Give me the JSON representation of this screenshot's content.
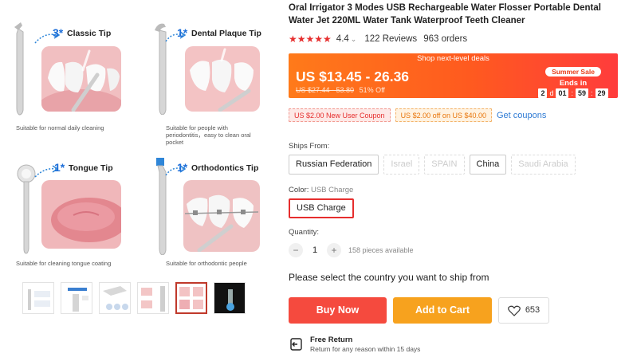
{
  "gallery": {
    "tiles": [
      {
        "num": "3*",
        "title": "Classic Tip",
        "caption": "Suitable for normal daily cleaning"
      },
      {
        "num": "1*",
        "title": "Dental Plaque Tip",
        "caption": "Suitable for people with periodontitis，easy to clean oral pocket"
      },
      {
        "num": "1*",
        "title": "Tongue Tip",
        "caption": "Suitable for cleaning tongue coating"
      },
      {
        "num": "1*",
        "title": "Orthodontics Tip",
        "caption": "Suitable for orthodontic people"
      }
    ],
    "thumbnails": [
      "thumb-1",
      "thumb-2",
      "thumb-3",
      "thumb-4",
      "thumb-5",
      "thumb-6"
    ],
    "active_thumbnail_index": 4
  },
  "product": {
    "title": "Oral Irrigator 3 Modes USB Rechargeable Water Flosser Portable Dental Water Jet 220ML Water Tank Waterproof Teeth Cleaner",
    "stars": "★★★★★",
    "rating": "4.4",
    "reviews": "122 Reviews",
    "orders": "963 orders"
  },
  "promo": {
    "banner": "Shop next-level deals",
    "price": "US $13.45 - 26.36",
    "old_price": "US $27.44 - 53.80",
    "discount": "51% Off",
    "badge": "Summer Sale",
    "ends_label": "Ends in",
    "timer": {
      "days": "2",
      "days_unit": "d",
      "hours": "01",
      "minutes": "59",
      "seconds": "29"
    }
  },
  "coupons": {
    "new_user": "US $2.00 New User Coupon",
    "off": "US $2.00 off on US $40.00",
    "link": "Get coupons"
  },
  "ships_from": {
    "label": "Ships From:",
    "options": [
      "Russian Federation",
      "Israel",
      "SPAIN",
      "China",
      "Saudi Arabia"
    ]
  },
  "color": {
    "label": "Color:",
    "value": "USB Charge",
    "options": [
      "USB Charge"
    ]
  },
  "quantity": {
    "label": "Quantity:",
    "minus": "−",
    "value": "1",
    "plus": "+",
    "available": "158 pieces available"
  },
  "ship_note": "Please select the country you want to ship from",
  "actions": {
    "buy_now": "Buy Now",
    "add_to_cart": "Add to Cart",
    "wishlist_count": "653"
  },
  "free_return": {
    "title": "Free Return",
    "desc": "Return for any reason within 15 days"
  },
  "colors": {
    "accent_red": "#e62e2e",
    "buy_now": "#f54a3e",
    "add_to_cart": "#f7a21e",
    "link_blue": "#2f7bd4"
  }
}
